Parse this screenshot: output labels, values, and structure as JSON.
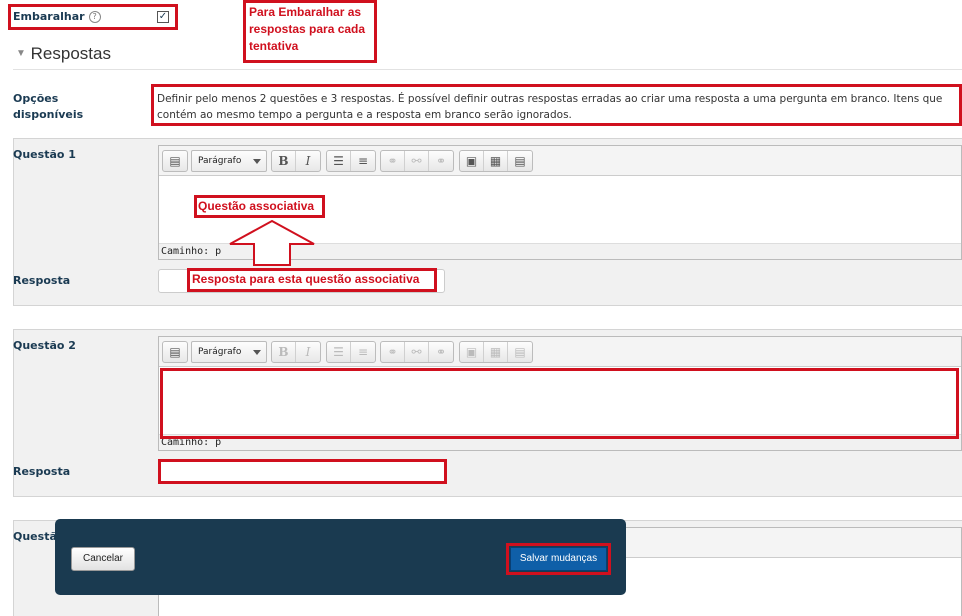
{
  "shuffle": {
    "label": "Embaralhar",
    "help_glyph": "?",
    "checked_glyph": "✓"
  },
  "annotations": {
    "shuffle_note": "Para Embaralhar as respostas para cada tentativa",
    "question_note": "Questão associativa",
    "answer_note": "Resposta para esta questão associativa"
  },
  "section": {
    "title": "Respostas"
  },
  "options": {
    "label": "Opções disponíveis",
    "text": "Definir pelo menos 2 questões e 3 respostas. É possível definir outras respostas erradas ao criar uma resposta a uma pergunta em branco. Itens que contém ao mesmo tempo a pergunta e a resposta em branco serão ignorados."
  },
  "editor": {
    "format_select": "Parágrafo",
    "path_label": "Caminho: p",
    "bold": "B",
    "italic": "I"
  },
  "questions": [
    {
      "label": "Questão 1",
      "answer_label": "Resposta",
      "answer_value": ""
    },
    {
      "label": "Questão 2",
      "answer_label": "Resposta",
      "answer_value": ""
    },
    {
      "label": "Questã"
    }
  ],
  "footer": {
    "cancel_label": "Cancelar",
    "save_label": "Salvar mudanças"
  },
  "colors": {
    "annotation": "#d0101e",
    "footer_bg": "#1a3a50",
    "save_button": "#0f5fa8",
    "label_text": "#1a3a52"
  }
}
